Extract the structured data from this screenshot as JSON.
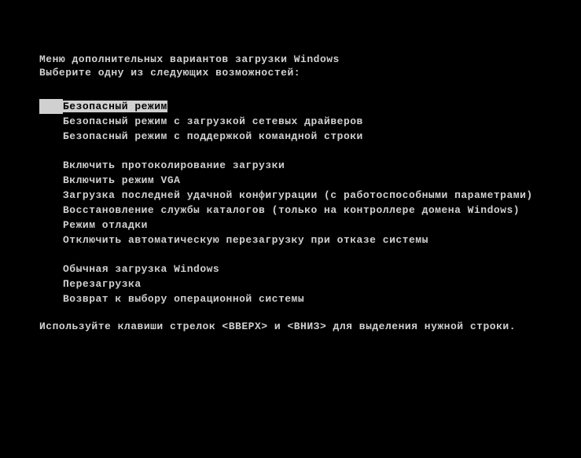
{
  "title": "Меню дополнительных вариантов загрузки Windows",
  "subtitle": "Выберите одну из следующих возможностей:",
  "groups": [
    {
      "items": [
        {
          "label": "Безопасный режим",
          "selected": true
        },
        {
          "label": "Безопасный режим с загрузкой сетевых драйверов",
          "selected": false
        },
        {
          "label": "Безопасный режим с поддержкой командной строки",
          "selected": false
        }
      ]
    },
    {
      "items": [
        {
          "label": "Включить протоколирование загрузки",
          "selected": false
        },
        {
          "label": "Включить режим VGA",
          "selected": false
        },
        {
          "label": "Загрузка последней удачной конфигурации (с работоспособными параметрами)",
          "selected": false
        },
        {
          "label": "Восстановление службы каталогов (только на контроллере домена Windows)",
          "selected": false
        },
        {
          "label": "Режим отладки",
          "selected": false
        },
        {
          "label": "Отключить автоматическую перезагрузку при отказе системы",
          "selected": false
        }
      ]
    },
    {
      "items": [
        {
          "label": "Обычная загрузка Windows",
          "selected": false
        },
        {
          "label": "Перезагрузка",
          "selected": false
        },
        {
          "label": "Возврат к выбору операционной системы",
          "selected": false
        }
      ]
    }
  ],
  "footer": "Используйте клавиши стрелок <ВВЕРХ> и <ВНИЗ> для выделения нужной строки."
}
